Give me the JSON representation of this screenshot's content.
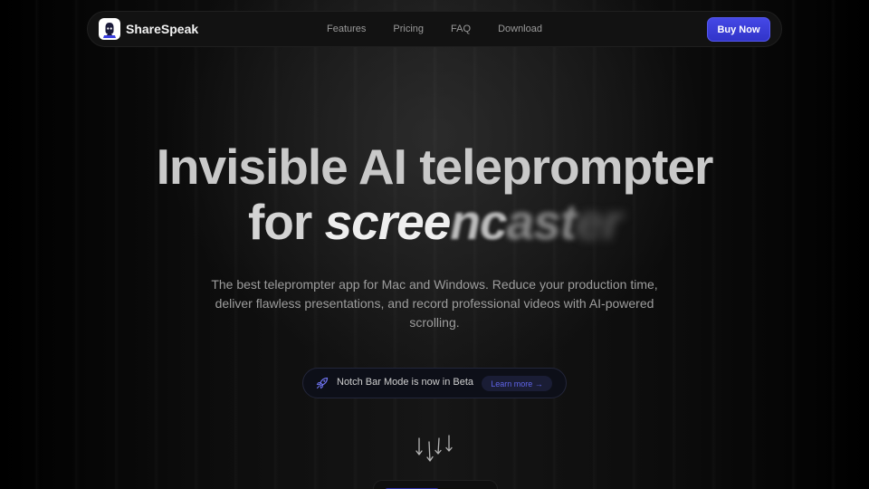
{
  "nav": {
    "brand": "ShareSpeak",
    "links": [
      {
        "label": "Features"
      },
      {
        "label": "Pricing"
      },
      {
        "label": "FAQ"
      },
      {
        "label": "Download"
      }
    ],
    "cta": "Buy Now"
  },
  "hero": {
    "line1": "Invisible AI teleprompter",
    "line2_prefix": "for",
    "animated_word": {
      "clear": "scree",
      "blur1": "nc",
      "blur2": "ast",
      "blur3": "er"
    },
    "subtitle": "The best teleprompter app for Mac and Windows. Reduce your production time, deliver flawless presentations, and record professional videos with AI-powered scrolling.",
    "announcement": {
      "icon": "rocket-icon",
      "text": "Notch Bar Mode is now in Beta",
      "link": "Learn more →"
    },
    "scroll_icon": "scroll-arrows-icon"
  },
  "colors": {
    "accent": "#3b3fe0",
    "background": "#000000",
    "headline": "#c9c9c9",
    "body_text": "#9d9d9d",
    "link_accent": "#5f64e8"
  }
}
